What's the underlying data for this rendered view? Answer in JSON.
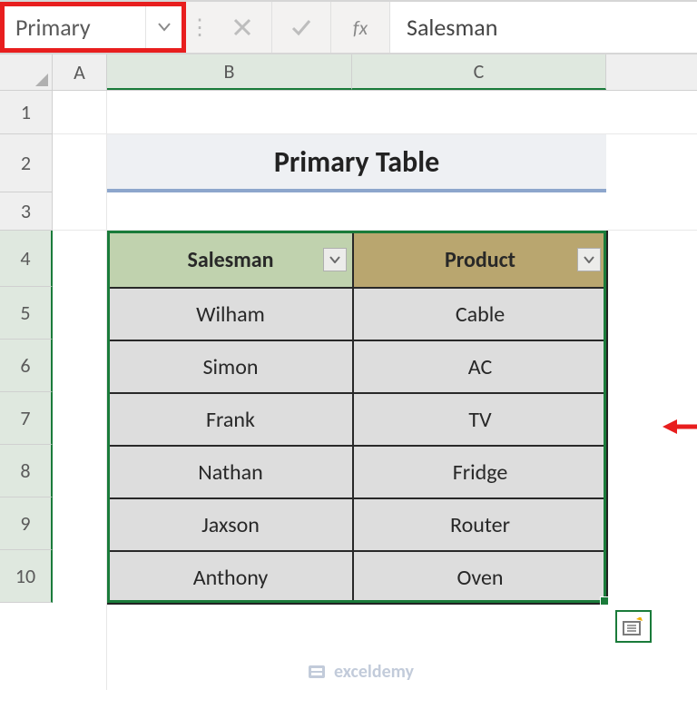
{
  "formula_bar": {
    "name_box": "Primary",
    "fx_label": "fx",
    "cell_value": "Salesman"
  },
  "columns": {
    "A": "A",
    "B": "B",
    "C": "C"
  },
  "rows": [
    "1",
    "2",
    "3",
    "4",
    "5",
    "6",
    "7",
    "8",
    "9",
    "10"
  ],
  "title": "Primary Table",
  "table": {
    "headers": {
      "salesman": "Salesman",
      "product": "Product"
    },
    "rows": [
      {
        "salesman": "Wilham",
        "product": "Cable"
      },
      {
        "salesman": "Simon",
        "product": "AC"
      },
      {
        "salesman": "Frank",
        "product": "TV"
      },
      {
        "salesman": "Nathan",
        "product": "Fridge"
      },
      {
        "salesman": "Jaxson",
        "product": "Router"
      },
      {
        "salesman": "Anthony",
        "product": "Oven"
      }
    ]
  },
  "watermark": "exceldemy",
  "colors": {
    "highlight": "#e81e1e",
    "selection": "#1a7b3a",
    "header_b": "#c7dbb4",
    "header_c": "#bfab6f"
  }
}
